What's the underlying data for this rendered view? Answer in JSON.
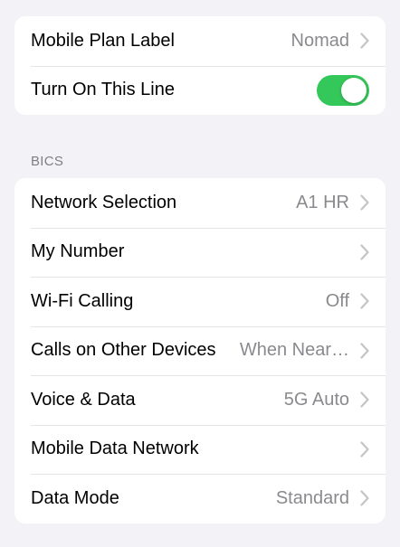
{
  "group1": {
    "mobile_plan_label": {
      "label": "Mobile Plan Label",
      "value": "Nomad"
    },
    "turn_on_line": {
      "label": "Turn On This Line",
      "enabled": true
    }
  },
  "section_header": "BICS",
  "group2": {
    "network_selection": {
      "label": "Network Selection",
      "value": "A1 HR"
    },
    "my_number": {
      "label": "My Number",
      "value": ""
    },
    "wifi_calling": {
      "label": "Wi-Fi Calling",
      "value": "Off"
    },
    "calls_other_devices": {
      "label": "Calls on Other Devices",
      "value": "When Near…"
    },
    "voice_data": {
      "label": "Voice & Data",
      "value": "5G Auto"
    },
    "mobile_data_network": {
      "label": "Mobile Data Network",
      "value": ""
    },
    "data_mode": {
      "label": "Data Mode",
      "value": "Standard"
    }
  },
  "colors": {
    "background": "#f2f2f7",
    "toggle_on": "#34c759",
    "secondary_text": "#8a8a8e",
    "chevron": "#c4c4c7"
  },
  "icons": {
    "disclosure": "chevron-right-icon"
  }
}
